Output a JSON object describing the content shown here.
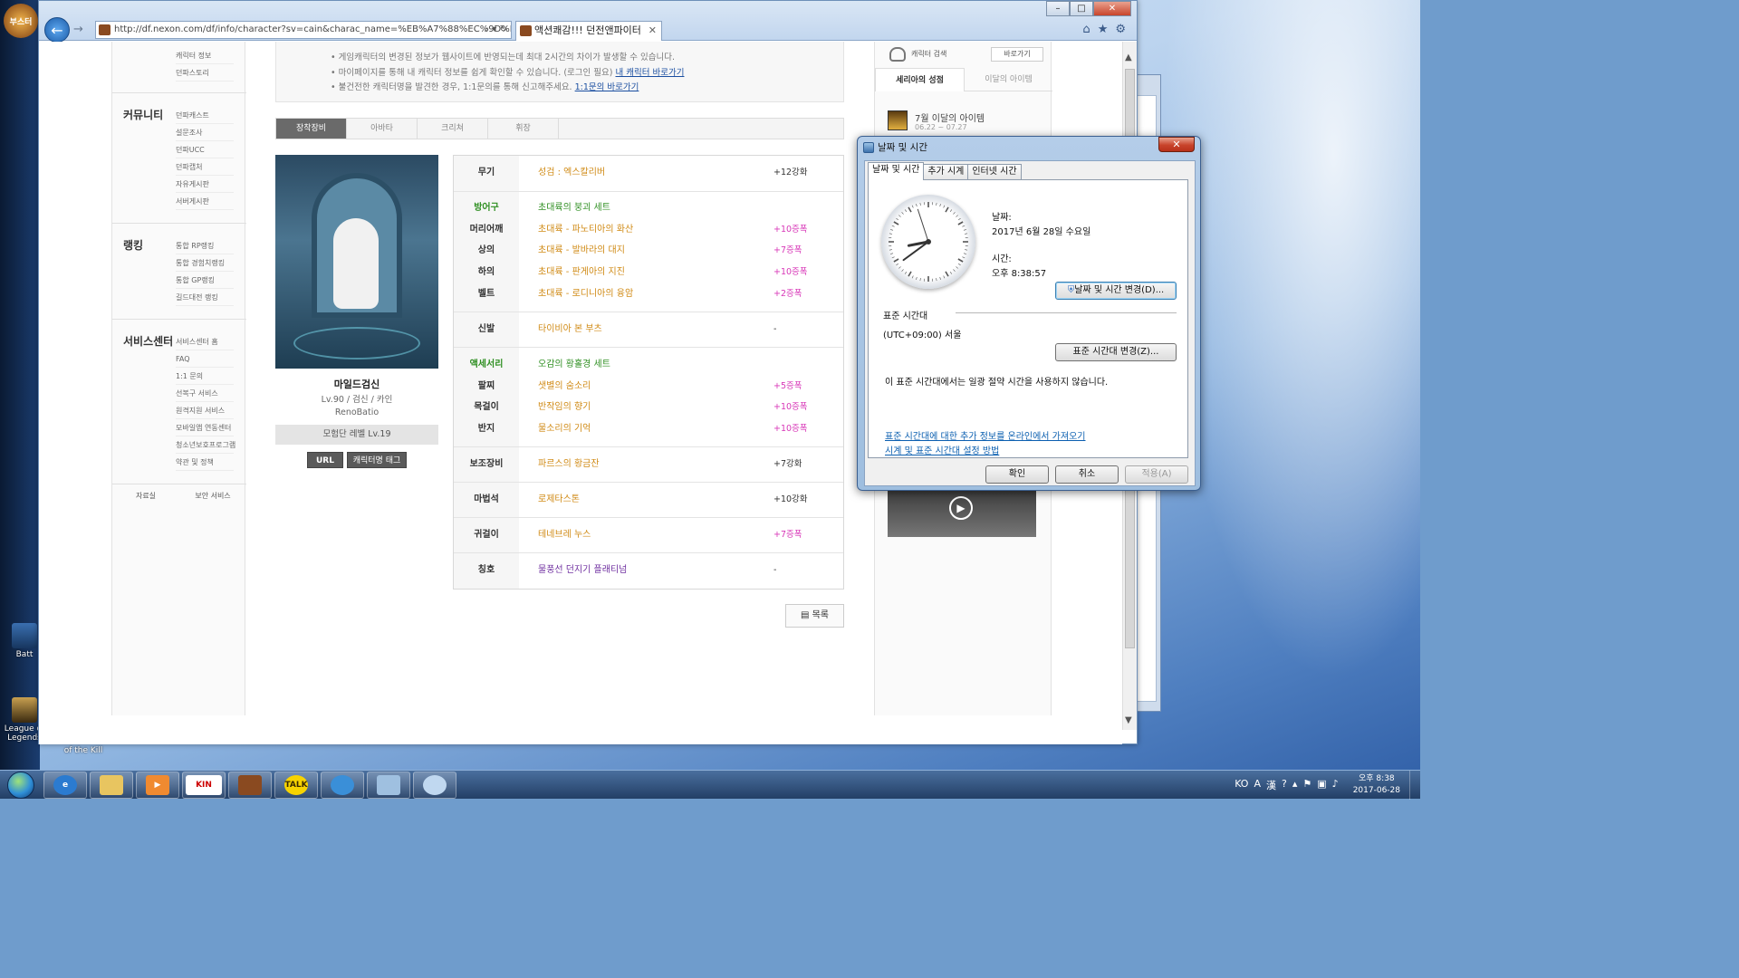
{
  "browser": {
    "address": "http://df.nexon.com/df/info/character?sv=cain&charac_name=%EB%A7%88%EC%9D%BC...",
    "tab_title": "액션쾌감!!! 던전앤파이터"
  },
  "leftnav": {
    "top_items": [
      "캐릭터 정보",
      "던파스토리"
    ],
    "sections": [
      {
        "title": "커뮤니티",
        "items": [
          "던파캐스트",
          "설문조사",
          "던파UCC",
          "던파캡처",
          "자유게시판",
          "서버게시판"
        ]
      },
      {
        "title": "랭킹",
        "items": [
          "통합 RP랭킹",
          "통합 경험치랭킹",
          "통합 GP랭킹",
          "길드대전 랭킹"
        ]
      },
      {
        "title": "서비스센터",
        "items": [
          "서비스센터 홈",
          "FAQ",
          "1:1 문의",
          "선복구 서비스",
          "원격지원 서비스",
          "모바일앱 연동센터",
          "청소년보호프로그램",
          "약관 및 정책"
        ]
      }
    ],
    "bottom": [
      "자료실",
      "보안 서비스"
    ]
  },
  "notice": {
    "line1": "게임캐릭터의 변경된 정보가 웹사이트에 반영되는데 최대 2시간의 차이가 발생할 수 있습니다.",
    "line2_prefix": "마이페이지를 통해 내 캐릭터 정보를 쉽게 확인할 수 있습니다. (로그인 필요)",
    "line2_link": "내 캐릭터 바로가기",
    "line3_prefix": "불건전한 캐릭터명을 발견한 경우, 1:1문의를 통해 신고해주세요.",
    "line3_link": "1:1문의 바로가기"
  },
  "tabs": [
    "장착장비",
    "아바타",
    "크리쳐",
    "휘장"
  ],
  "character": {
    "name": "마일드검신",
    "info": "Lv.90 / 검신 / 카인",
    "guild": "RenoBatio",
    "adventure": "모험단 레벨 Lv.19",
    "url_button": "URL",
    "tag_button": "캐릭터명 태그"
  },
  "equipment": {
    "weapon": {
      "slot": "무기",
      "name": "성검 : 엑스칼리버",
      "value": "+12강화"
    },
    "armor_set": {
      "slot": "방어구",
      "name": "초대륙의 붕괴 세트"
    },
    "shoulder": {
      "slot": "머리어깨",
      "name": "초대륙 - 파노티아의 화산",
      "value": "+10증폭"
    },
    "top": {
      "slot": "상의",
      "name": "초대륙 - 발바라의 대지",
      "value": "+7증폭"
    },
    "bottom": {
      "slot": "하의",
      "name": "초대륙 - 판게아의 지진",
      "value": "+10증폭"
    },
    "belt": {
      "slot": "벨트",
      "name": "초대륙 - 로디니아의 융암",
      "value": "+2증폭"
    },
    "shoes": {
      "slot": "신발",
      "name": "타이비아 본 부츠",
      "value": "-"
    },
    "acc_set": {
      "slot": "액세서리",
      "name": "오감의 황홀경 세트"
    },
    "bracelet": {
      "slot": "팔찌",
      "name": "샛별의 숨소리",
      "value": "+5증폭"
    },
    "necklace": {
      "slot": "목걸이",
      "name": "반작임의 향기",
      "value": "+10증폭"
    },
    "ring": {
      "slot": "반지",
      "name": "물소리의 기억",
      "value": "+10증폭"
    },
    "sub": {
      "slot": "보조장비",
      "name": "파르스의 황금잔",
      "value": "+7강화"
    },
    "magic": {
      "slot": "마법석",
      "name": "로제타스톤",
      "value": "+10강화"
    },
    "earring": {
      "slot": "귀걸이",
      "name": "테네브레 누스",
      "value": "+7증폭"
    },
    "title": {
      "slot": "칭호",
      "name": "물풍선 던지기 플래티넘",
      "value": "-"
    }
  },
  "list_button": "목록",
  "rightcol": {
    "search_label": "캐릭터 검색",
    "goto_button": "바로가기",
    "tab1": "세리아의 성점",
    "tab2": "이달의 아이템",
    "item_title": "7월 이달의 아이템",
    "item_date": "06.22 ~ 07.27"
  },
  "dialog": {
    "title": "날짜 및 시간",
    "tabs": [
      "날짜 및 시간",
      "추가 시계",
      "인터넷 시간"
    ],
    "date_label": "날짜:",
    "date_value": "2017년 6월 28일 수요일",
    "time_label": "시간:",
    "time_value": "오후 8:38:57",
    "change_datetime": "날짜 및 시간 변경(D)...",
    "tz_heading": "표준 시간대",
    "tz_value": "(UTC+09:00) 서울",
    "change_tz": "표준 시간대 변경(Z)...",
    "dst_note": "이 표준 시간대에서는 일광 절약 시간을 사용하지 않습니다.",
    "link1": "표준 시간대에 대한 추가 정보를 온라인에서 가져오기",
    "link2": "시계 및 표준 시간대 설정 방법",
    "ok": "확인",
    "cancel": "취소",
    "apply": "적용(A)",
    "clock": {
      "hour": 8,
      "minute": 38,
      "second": 57
    }
  },
  "desktop": {
    "game_logo": "부스터",
    "icons": [
      "Batt",
      "League of Legends",
      "of the Kill"
    ]
  },
  "taskbar": {
    "apps": [
      "ie",
      "explorer",
      "media",
      "KIN",
      "dnf",
      "TALK",
      "app7",
      "app8",
      "app9"
    ],
    "lang": "KO",
    "time": "오후 8:38",
    "date": "2017-06-28"
  }
}
